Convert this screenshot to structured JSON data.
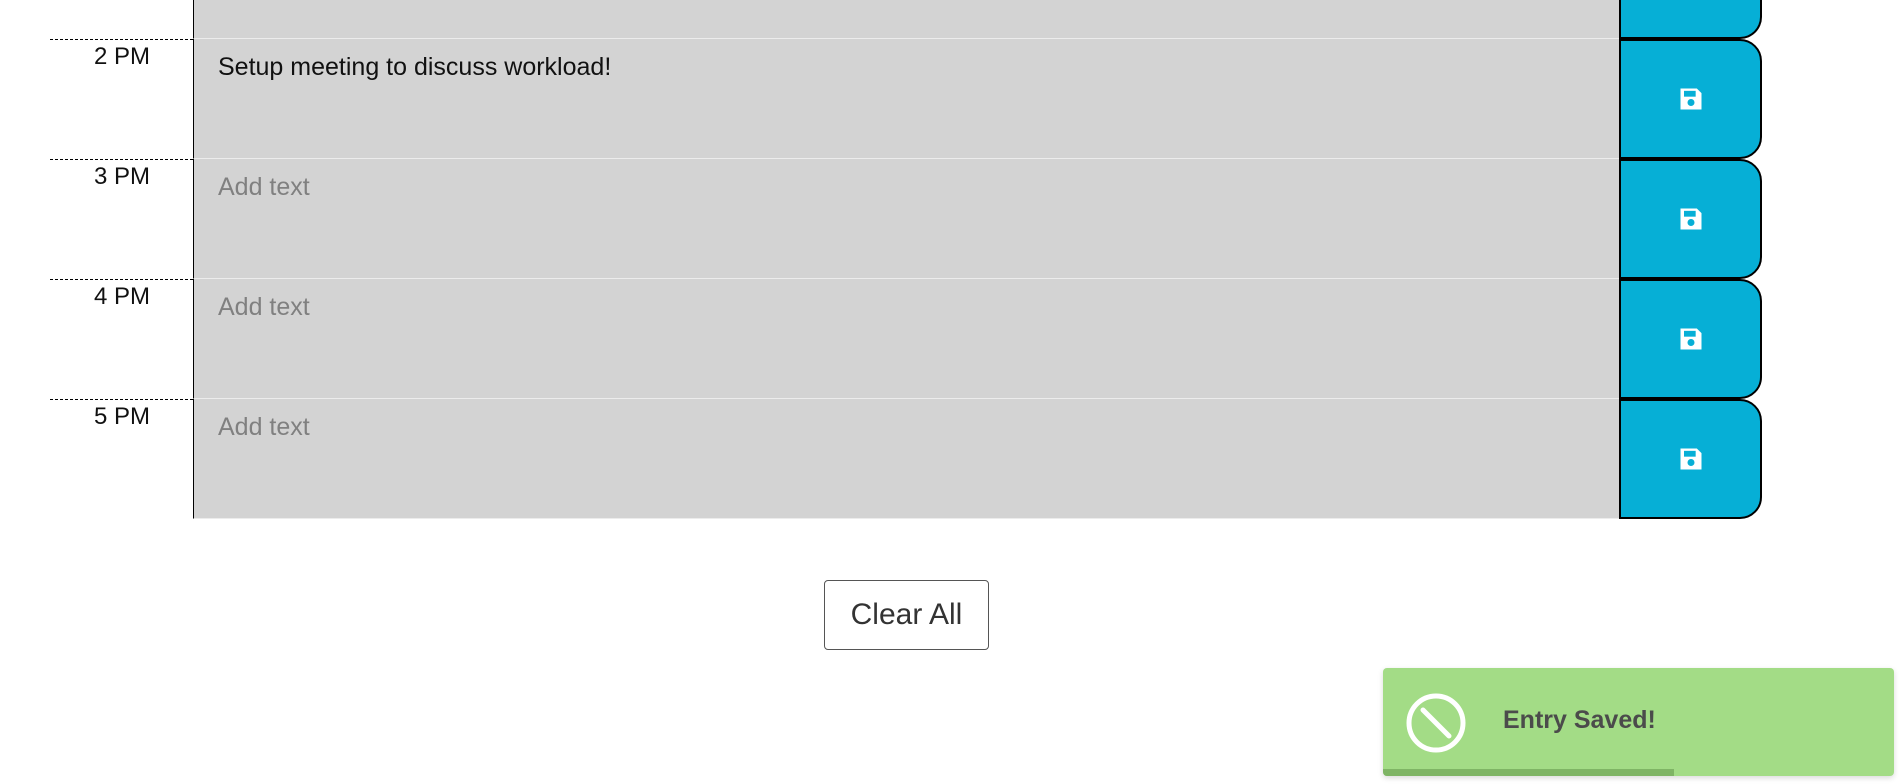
{
  "rows": [
    {
      "hour": "",
      "text": "",
      "placeholder": ""
    },
    {
      "hour": "2 PM",
      "text": "Setup meeting to discuss workload!",
      "placeholder": "Add text"
    },
    {
      "hour": "3 PM",
      "text": "",
      "placeholder": "Add text"
    },
    {
      "hour": "4 PM",
      "text": "",
      "placeholder": "Add text"
    },
    {
      "hour": "5 PM",
      "text": "",
      "placeholder": "Add text"
    }
  ],
  "clear_button": {
    "label": "Clear All"
  },
  "toast": {
    "message": "Entry Saved!",
    "progress": 0.57,
    "icon": "ban-circle-icon"
  },
  "save_icon": "floppy-disk-icon",
  "colors": {
    "save_button": "#06afd6",
    "description_bg": "#d3d3d3",
    "toast_bg": "#a3dc86",
    "toast_progress": "#7fb565"
  }
}
